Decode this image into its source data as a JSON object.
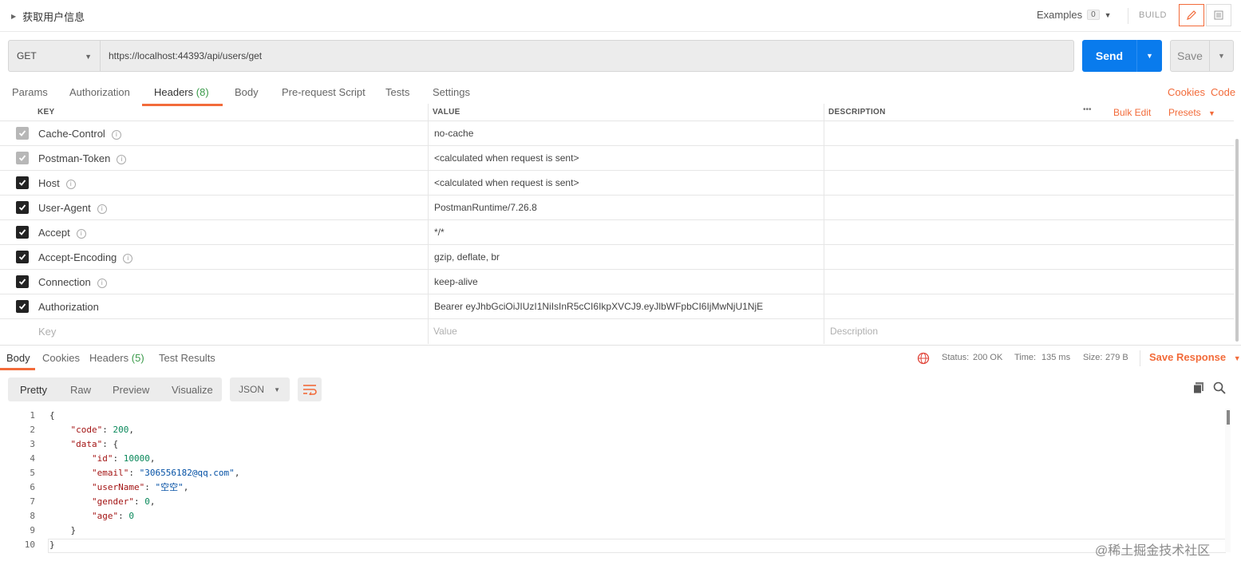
{
  "request": {
    "name": "获取用户信息",
    "examples_label": "Examples",
    "examples_count": "0",
    "build_label": "BUILD",
    "method": "GET",
    "url": "https://localhost:44393/api/users/get",
    "send_label": "Send",
    "save_label": "Save"
  },
  "req_tabs": {
    "params": "Params",
    "authorization": "Authorization",
    "headers": "Headers",
    "headers_count": "(8)",
    "body": "Body",
    "prerequest": "Pre-request Script",
    "tests": "Tests",
    "settings": "Settings",
    "cookies": "Cookies",
    "code": "Code"
  },
  "headers_table": {
    "col_key": "KEY",
    "col_value": "VALUE",
    "col_description": "DESCRIPTION",
    "more": "•••",
    "bulk_edit": "Bulk Edit",
    "presets": "Presets",
    "rows": [
      {
        "key": "Cache-Control",
        "value": "no-cache"
      },
      {
        "key": "Postman-Token",
        "value": "<calculated when request is sent>"
      },
      {
        "key": "Host",
        "value": "<calculated when request is sent>"
      },
      {
        "key": "User-Agent",
        "value": "PostmanRuntime/7.26.8"
      },
      {
        "key": "Accept",
        "value": "*/*"
      },
      {
        "key": "Accept-Encoding",
        "value": "gzip, deflate, br"
      },
      {
        "key": "Connection",
        "value": "keep-alive"
      },
      {
        "key": "Authorization",
        "value": "Bearer eyJhbGciOiJIUzI1NiIsInR5cCI6IkpXVCJ9.eyJlbWFpbCI6IjMwNjU1NjE"
      }
    ],
    "placeholder_key": "Key",
    "placeholder_value": "Value",
    "placeholder_description": "Description"
  },
  "response": {
    "tabs": {
      "body": "Body",
      "cookies": "Cookies",
      "headers": "Headers",
      "headers_count": "(5)",
      "test_results": "Test Results"
    },
    "status_label": "Status:",
    "status_value": "200 OK",
    "time_label": "Time:",
    "time_value": "135 ms",
    "size_label": "Size:",
    "size_value": "279 B",
    "save_response": "Save Response",
    "view_modes": {
      "pretty": "Pretty",
      "raw": "Raw",
      "preview": "Preview",
      "visualize": "Visualize"
    },
    "format": "JSON",
    "body_lines": [
      {
        "no": "1",
        "text": "{"
      },
      {
        "no": "2",
        "text": "    \"code\": 200,"
      },
      {
        "no": "3",
        "text": "    \"data\": {"
      },
      {
        "no": "4",
        "text": "        \"id\": 10000,"
      },
      {
        "no": "5",
        "text": "        \"email\": \"306556182@qq.com\","
      },
      {
        "no": "6",
        "text": "        \"userName\": \"空空\","
      },
      {
        "no": "7",
        "text": "        \"gender\": 0,"
      },
      {
        "no": "8",
        "text": "        \"age\": 0"
      },
      {
        "no": "9",
        "text": "    }"
      },
      {
        "no": "10",
        "text": "}"
      }
    ]
  },
  "watermark": "@稀土掘金技术社区",
  "colors": {
    "accent": "#f26b3a",
    "send": "#097bed",
    "status_ok": "#3a9a4a"
  }
}
